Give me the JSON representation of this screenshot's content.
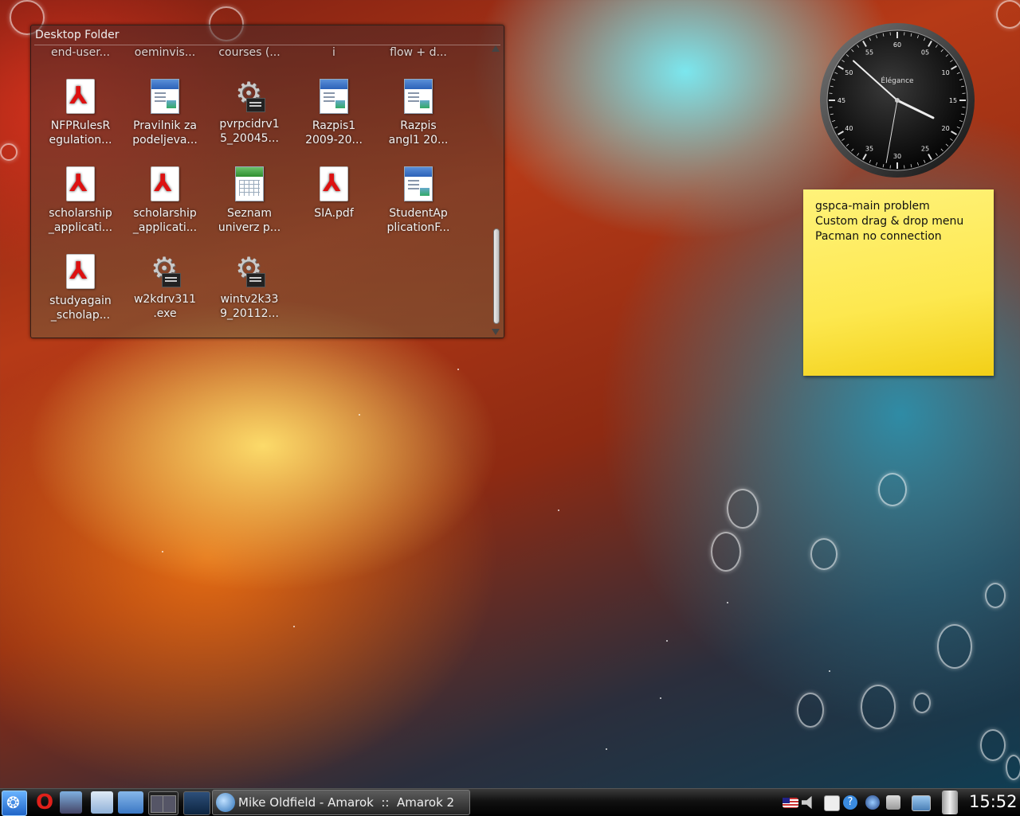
{
  "desktop_folder": {
    "title": "Desktop Folder",
    "top_row_labels": [
      "end-user...",
      "oeminvis...",
      "courses (...",
      "i",
      "flow + d..."
    ],
    "items": [
      {
        "label": "NFPRulesR\negulation...",
        "icon": "pdf-file-icon"
      },
      {
        "label": "Pravilnik za\npodeljeva...",
        "icon": "text-document-icon"
      },
      {
        "label": "pvrpcidrv1\n5_20045...",
        "icon": "executable-gear-icon"
      },
      {
        "label": "Razpis1\n2009-20...",
        "icon": "text-document-icon"
      },
      {
        "label": "Razpis\nangl1 20...",
        "icon": "text-document-icon"
      },
      {
        "label": "scholarship\n_applicati...",
        "icon": "pdf-file-icon"
      },
      {
        "label": "scholarship\n_applicati...",
        "icon": "pdf-file-icon"
      },
      {
        "label": "Seznam\nuniverz p...",
        "icon": "spreadsheet-icon"
      },
      {
        "label": "SIA.pdf",
        "icon": "pdf-file-icon"
      },
      {
        "label": "StudentAp\nplicationF...",
        "icon": "text-document-icon"
      },
      {
        "label": "studyagain\n_scholap...",
        "icon": "pdf-file-icon"
      },
      {
        "label": "w2kdrv311\n.exe",
        "icon": "executable-gear-icon"
      },
      {
        "label": "wintv2k33\n9_20112...",
        "icon": "executable-gear-icon"
      }
    ]
  },
  "analog_clock": {
    "brand": "Élégance",
    "numbers": [
      "60",
      "05",
      "10",
      "15",
      "20",
      "25",
      "30",
      "35",
      "40",
      "45",
      "50",
      "55"
    ],
    "time": "15:52"
  },
  "sticky_note": {
    "lines": [
      "gspca-main problem",
      "Custom drag & drop menu",
      "Pacman no connection"
    ]
  },
  "taskbar": {
    "launchers": [
      "kickoff-menu-icon",
      "opera-icon",
      "users-icon",
      "notepad-icon",
      "folder-star-icon",
      "pager-icon",
      "show-desktop-icon"
    ],
    "task_label": "Mike Oldfield - Amarok  ::  Amarok 2",
    "clock": "15:52"
  },
  "colors": {
    "note_yellow": "#fde84f",
    "taskbar_black": "#111111"
  }
}
